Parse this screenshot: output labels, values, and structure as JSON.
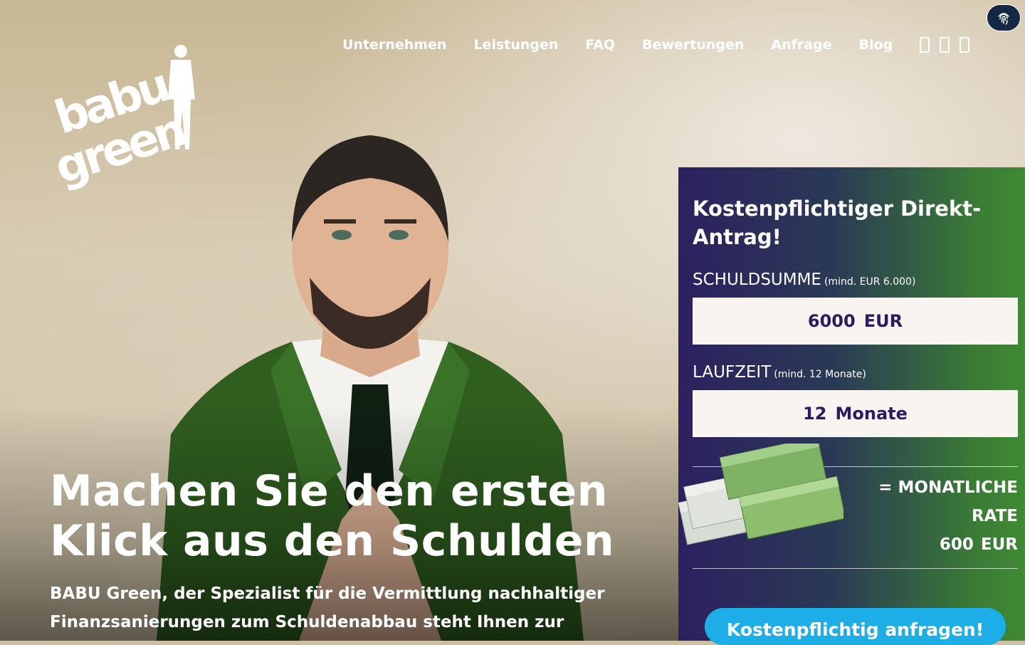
{
  "brand": {
    "logo_line1": "babu",
    "logo_line2": "green",
    "logo_icon": "businessman-silhouette"
  },
  "nav": {
    "items": [
      {
        "label": "Unternehmen"
      },
      {
        "label": "Leistungen"
      },
      {
        "label": "FAQ"
      },
      {
        "label": "Bewertungen"
      },
      {
        "label": "Anfrage"
      },
      {
        "label": "Blog"
      }
    ],
    "icons": [
      "social-icon",
      "social-icon",
      "social-icon"
    ],
    "privacy_icon": "fingerprint-icon"
  },
  "hero": {
    "headline": "Machen Sie den ersten Klick aus den Schulden",
    "subtext": "BABU Green, der Spezialist für die Vermittlung nachhaltiger Finanzsanierungen zum Schuldenabbau steht Ihnen zur"
  },
  "calculator": {
    "title": "Kostenpflichtiger Direkt-Antrag!",
    "debt": {
      "label": "SCHULDSUMME",
      "hint": "(mind. EUR 6.000)",
      "value": "6000",
      "unit": "EUR"
    },
    "term": {
      "label": "LAUFZEIT",
      "hint": "(mind. 12 Monate)",
      "value": "12",
      "unit": "Monate"
    },
    "rate": {
      "label_line1": "= MONATLICHE",
      "label_line2": "RATE",
      "value": "600",
      "unit": "EUR"
    },
    "cta_label": "Kostenpflichtig anfragen!"
  },
  "colors": {
    "panel_start": "#2d2060",
    "panel_end": "#3f8a34",
    "cta": "#1daee8",
    "field_text": "#2d1b5e",
    "suit_green": "#2f5e1f"
  }
}
